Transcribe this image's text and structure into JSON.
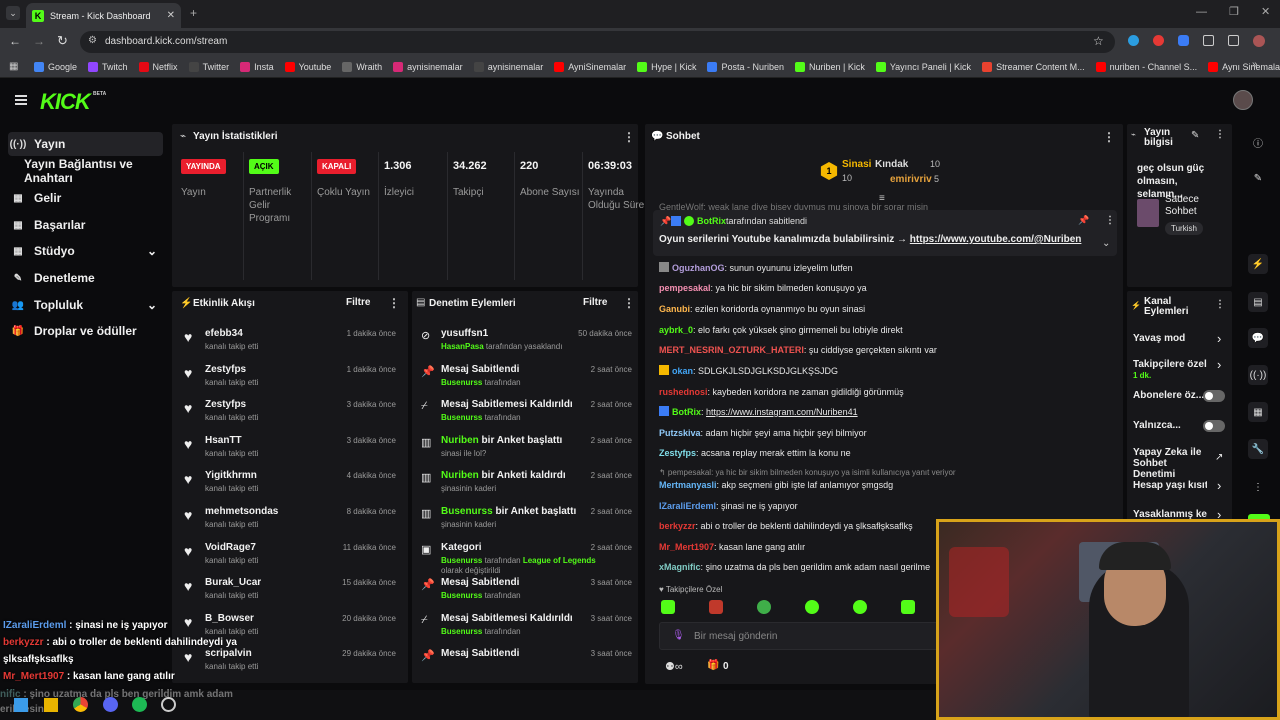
{
  "browser": {
    "tab_title": "Stream - Kick Dashboard",
    "url": "dashboard.kick.com/stream",
    "bookmarks": [
      {
        "label": "Google",
        "color": "#4285f4"
      },
      {
        "label": "Twitch",
        "color": "#9146ff"
      },
      {
        "label": "Netflix",
        "color": "#e50914"
      },
      {
        "label": "Twitter",
        "color": "#444444"
      },
      {
        "label": "Insta",
        "color": "#d62976"
      },
      {
        "label": "Youtube",
        "color": "#ff0000"
      },
      {
        "label": "Wraith",
        "color": "#666666"
      },
      {
        "label": "aynisinemalar",
        "color": "#d62976"
      },
      {
        "label": "aynisinemalar",
        "color": "#444444"
      },
      {
        "label": "AyniSinemalar",
        "color": "#ff0000"
      },
      {
        "label": "Hype | Kick",
        "color": "#53fc18"
      },
      {
        "label": "Posta - Nuriben",
        "color": "#3b7cf5"
      },
      {
        "label": "Nuriben | Kick",
        "color": "#53fc18"
      },
      {
        "label": "Yayıncı Paneli | Kick",
        "color": "#53fc18"
      },
      {
        "label": "Streamer Content M...",
        "color": "#e8422f"
      },
      {
        "label": "nuriben - Channel S...",
        "color": "#ff0000"
      },
      {
        "label": "Aynı Sinemalar - Ça...",
        "color": "#ff0000"
      }
    ]
  },
  "logo": "KICK",
  "logo_beta": "BETA",
  "nav": [
    {
      "label": "Yayın",
      "icon": "broadcast-icon",
      "glyph": "((·))",
      "active": true,
      "chev": ""
    },
    {
      "label": "Yayın Bağlantısı ve Anahtarı",
      "icon": "",
      "glyph": "",
      "active": false,
      "chev": ""
    },
    {
      "label": "Gelir",
      "icon": "money-icon",
      "glyph": "▦",
      "active": false,
      "chev": ""
    },
    {
      "label": "Başarılar",
      "icon": "trophy-icon",
      "glyph": "▦",
      "active": false,
      "chev": ""
    },
    {
      "label": "Stüdyo",
      "icon": "studio-icon",
      "glyph": "▦",
      "active": false,
      "chev": "⌄"
    },
    {
      "label": "Denetleme",
      "icon": "wrench-icon",
      "glyph": "✎",
      "active": false,
      "chev": ""
    },
    {
      "label": "Topluluk",
      "icon": "people-icon",
      "glyph": "👥",
      "active": false,
      "chev": "⌄"
    },
    {
      "label": "Droplar ve ödüller",
      "icon": "gift-icon",
      "glyph": "🎁",
      "active": false,
      "chev": ""
    }
  ],
  "stats": {
    "title": "Yayın İstatistikleri",
    "items": [
      {
        "badge": "YAYINDA",
        "badge_bg": "#e91e2d",
        "badge_fg": "#ffffff",
        "label": "Yayın"
      },
      {
        "badge": "AÇIK",
        "badge_bg": "#53fc18",
        "badge_fg": "#000000",
        "label": "Partnerlik Gelir Programı"
      },
      {
        "badge": "KAPALI",
        "badge_bg": "#e91e2d",
        "badge_fg": "#ffffff",
        "label": "Çoklu Yayın"
      },
      {
        "value": "1.306",
        "label": "İzleyici"
      },
      {
        "value": "34.262",
        "label": "Takipçi"
      },
      {
        "value": "220",
        "label": "Abone Sayısı"
      },
      {
        "value": "06:39:03",
        "label": "Yayında Olduğu Süre"
      }
    ]
  },
  "activity": {
    "title": "Etkinlik Akışı",
    "filter": "Filtre",
    "items": [
      {
        "name": "efebb34",
        "sub": "kanalı takip etti",
        "time": "1 dakika önce"
      },
      {
        "name": "Zestyfps",
        "sub": "kanalı takip etti",
        "time": "1 dakika önce"
      },
      {
        "name": "Zestyfps",
        "sub": "kanalı takip etti",
        "time": "3 dakika önce"
      },
      {
        "name": "HsanTT",
        "sub": "kanalı takip etti",
        "time": "3 dakika önce"
      },
      {
        "name": "Yigitkhrmn",
        "sub": "kanalı takip etti",
        "time": "4 dakika önce"
      },
      {
        "name": "mehmetsondas",
        "sub": "kanalı takip etti",
        "time": "8 dakika önce"
      },
      {
        "name": "VoidRage7",
        "sub": "kanalı takip etti",
        "time": "11 dakika önce"
      },
      {
        "name": "Burak_Ucar",
        "sub": "kanalı takip etti",
        "time": "15 dakika önce"
      },
      {
        "name": "B_Bowser",
        "sub": "kanalı takip etti",
        "time": "20 dakika önce"
      },
      {
        "name": "scripalvin",
        "sub": "kanalı takip etti",
        "time": "29 dakika önce"
      }
    ]
  },
  "modlog": {
    "title": "Denetim Eylemleri",
    "filter": "Filtre",
    "items": [
      {
        "icon": "ban-icon",
        "glyph": "⊘",
        "pre": "",
        "title": "yusuffsn1",
        "who": "HasanPasa",
        "action": " tarafından yasaklandı",
        "extra": "",
        "time": "50 dakika önce"
      },
      {
        "icon": "pin-icon",
        "glyph": "📌",
        "pre": "",
        "title": "Mesaj Sabitlendi",
        "who": "Busenurss",
        "action": " tarafından",
        "extra": "",
        "time": "2 saat önce"
      },
      {
        "icon": "unpin-icon",
        "glyph": "⌿",
        "pre": "",
        "title": "Mesaj Sabitlemesi Kaldırıldı",
        "who": "Busenurss",
        "action": " tarafından",
        "extra": "",
        "time": "2 saat önce"
      },
      {
        "icon": "poll-icon",
        "glyph": "▥",
        "pre": "Nuriben",
        "title": " bir Anket başlattı",
        "who": "",
        "action": "sinasi ile lol?",
        "extra": "",
        "time": "2 saat önce"
      },
      {
        "icon": "poll-icon",
        "glyph": "▥",
        "pre": "Nuriben",
        "title": " bir Anketi kaldırdı",
        "who": "",
        "action": "şinasinin kaderi",
        "extra": "",
        "time": "2 saat önce"
      },
      {
        "icon": "poll-icon",
        "glyph": "▥",
        "pre": "Busenurss",
        "title": " bir Anket başlattı",
        "who": "",
        "action": "şinasinin kaderi",
        "extra": "",
        "time": "2 saat önce"
      },
      {
        "icon": "category-icon",
        "glyph": "▣",
        "pre": "",
        "title": "Kategori",
        "who": "Busenurss",
        "action": " tarafından ",
        "extra": "League of Legends",
        "extra2": " olarak değiştirildi",
        "time": "2 saat önce"
      },
      {
        "icon": "pin-icon",
        "glyph": "📌",
        "pre": "",
        "title": "Mesaj Sabitlendi",
        "who": "Busenurss",
        "action": " tarafından",
        "extra": "",
        "time": "3 saat önce"
      },
      {
        "icon": "unpin-icon",
        "glyph": "⌿",
        "pre": "",
        "title": "Mesaj Sabitlemesi Kaldırıldı",
        "who": "Busenurss",
        "action": " tarafından",
        "extra": "",
        "time": "3 saat önce"
      },
      {
        "icon": "pin-icon",
        "glyph": "📌",
        "pre": "",
        "title": "Mesaj Sabitlendi",
        "who": "",
        "action": "",
        "extra": "",
        "time": "3 saat önce"
      }
    ]
  },
  "chat": {
    "title": "Sohbet",
    "leaders": [
      {
        "rank": "1",
        "name": "Sinasi",
        "count": "10"
      },
      {
        "name": "Kındak",
        "count": "10"
      },
      {
        "name": "emirivriv",
        "count": "5"
      }
    ],
    "clipped": "GentleWolf: weak lane diye bişey duymus mu sinova bir sorar misin",
    "pinned_by": "BotRix",
    "pinned_by_suffix": " tarafından sabitlendi",
    "pinned_text": "Oyun serilerini Youtube kanalımızda bulabilirsiniz → ",
    "pinned_link": "https://www.youtube.com/@Nuriben",
    "messages": [
      {
        "user": "OguzhanOG",
        "color": "#b39ddb",
        "text": ": sunun oyununu izleyelim lutfen"
      },
      {
        "user": "pempesakal",
        "color": "#f48fb1",
        "text": ": ya hic bir sikim bilmeden konuşuyo ya"
      },
      {
        "user": "Ganubi",
        "color": "#ffb74d",
        "text": ": ezilen koridorda oynanmıyo bu oyun sinasi"
      },
      {
        "user": "aybrk_0",
        "color": "#53fc18",
        "text": ": elo farkı çok yüksek şino girmemeli bu lobiyle direkt"
      },
      {
        "user": "MERT_NESRIN_OZTURK_HATERI",
        "color": "#ef5350",
        "text": ": şu ciddiyse gerçekten sıkıntı var"
      },
      {
        "user": "okan",
        "color": "#42a5f5",
        "text": ": SDLGKJLSDJGLKSDJGLKŞSJDG"
      },
      {
        "user": "rushednosi",
        "color": "#e53935",
        "text": ": kaybeden koridora ne zaman gidildiği görünmüş"
      },
      {
        "user": "BotRix",
        "color": "#53fc18",
        "text": ": ",
        "link": "https://www.instagram.com/Nuriben41"
      },
      {
        "user": "Putzskiva",
        "color": "#90caf9",
        "text": ": adam hiçbir şeyi ama hiçbir şeyi bilmiyor"
      },
      {
        "user": "Zestyfps",
        "color": "#80deea",
        "text": ": acsana replay merak ettim la konu ne"
      },
      {
        "reply": "↰ pempesakal: ya hic bir sikim bilmeden konuşuyo ya isimli kullanıcıya yanıt veriyor"
      },
      {
        "user": "Mertmanyasli",
        "color": "#64b5f6",
        "text": ": akp seçmeni gibi işte laf anlamıyor şmgsdg"
      },
      {
        "user": "IZaraliErdeml",
        "color": "#5c9ded",
        "text": ": şinasi ne iş yapıyor"
      },
      {
        "user": "berkyzzr",
        "color": "#e53935",
        "text": ": abi o troller de beklenti dahilindeydi ya şlksafłşksaflkş"
      },
      {
        "user": "Mr_Mert1907",
        "color": "#e53935",
        "text": ": kasan lane gang atılır"
      },
      {
        "user": "xMagnific",
        "color": "#80cbc4",
        "text": ": şino uzatma da pls ben gerildim amk adam nasıl gerilme"
      }
    ],
    "followers_only": "Takipçilere Özel",
    "placeholder": "Bir mesaj gönderin",
    "count": "0"
  },
  "streaminfo": {
    "title": "Yayın bilgisi",
    "desc": "geç olsun güç olmasın, selamın...",
    "category": "Sadece Sohbet",
    "tag": "Turkish"
  },
  "channel": {
    "title": "Kanal Eylemleri",
    "items": [
      {
        "label": "Yavaş mod",
        "sub": "",
        "kind": "chev"
      },
      {
        "label": "Takipçilere özel s",
        "sub": "1 dk.",
        "kind": "chev"
      },
      {
        "label": "Abonelere öz...",
        "sub": "",
        "kind": "toggle"
      },
      {
        "label": "Yalnızca...",
        "sub": "",
        "kind": "toggle"
      },
      {
        "label": "Yapay Zeka ile Sohbet Denetimi",
        "sub": "",
        "kind": "ext"
      },
      {
        "label": "Hesap yaşı kısıtla",
        "sub": "",
        "kind": "chev"
      },
      {
        "label": "Yasaklanmış kelin",
        "sub": "",
        "kind": "chev"
      }
    ]
  },
  "overlay": [
    {
      "user": "IZaraliErdeml",
      "color": "#5c9ded",
      "text": " : şinasi ne iş yapıyor"
    },
    {
      "user": "berkyzzr",
      "color": "#e53935",
      "text": " : abi o troller de beklenti dahilindeydi ya"
    },
    {
      "user": "",
      "color": "#ffffff",
      "text": "şlksafłşksaflkş"
    },
    {
      "user": "Mr_Mert1907",
      "color": "#e53935",
      "text": " : kasan lane gang atılır"
    },
    {
      "user": "nific",
      "color": "#80cbc4",
      "text": " : şino uzatma da pls ben gerildim amk adam"
    },
    {
      "user": "",
      "color": "#ffffff",
      "text": "erilmesin"
    }
  ]
}
